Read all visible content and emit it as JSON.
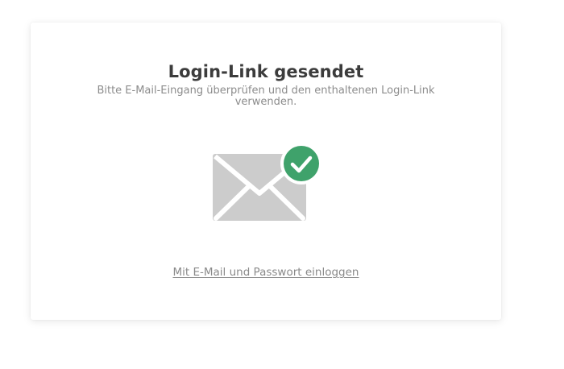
{
  "card": {
    "title": "Login-Link gesendet",
    "subtitle": "Bitte E-Mail-Eingang überprüfen und den enthaltenen Login-Link verwenden.",
    "illustration": {
      "envelope_icon": "envelope-icon",
      "check_icon": "check-circle-icon",
      "envelope_color": "#cccccc",
      "check_color": "#3fa26b"
    },
    "password_login_link": "Mit E-Mail und Passwort einloggen"
  }
}
